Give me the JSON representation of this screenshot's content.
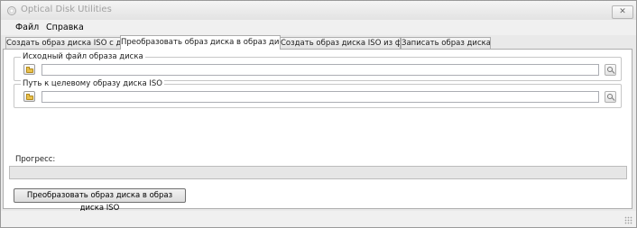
{
  "window": {
    "title": "Optical Disk Utilities",
    "close_glyph": "✕"
  },
  "menu": [
    {
      "label": "Файл"
    },
    {
      "label": "Справка"
    }
  ],
  "tabs": [
    {
      "label": "Создать образ диска ISO с диска",
      "active": false
    },
    {
      "label": "Преобразовать образ диска в образ диска ISO",
      "active": true
    },
    {
      "label": "Создать образ диска ISO из файлов",
      "active": false
    },
    {
      "label": "Записать образ диска ISO",
      "active": false
    }
  ],
  "source": {
    "label": "Исходный файл образа диска",
    "value": "",
    "browse_icon": "folder-icon",
    "search_icon": "search-icon"
  },
  "target": {
    "label": "Путь к целевому образу диска ISO",
    "value": "",
    "browse_icon": "folder-icon",
    "search_icon": "search-icon"
  },
  "progress": {
    "label": "Прогресс:",
    "percent": 0
  },
  "action": {
    "label": "Преобразовать образ диска в образ диска ISO"
  },
  "status": {
    "grip_icon": "size-grip-icon"
  }
}
